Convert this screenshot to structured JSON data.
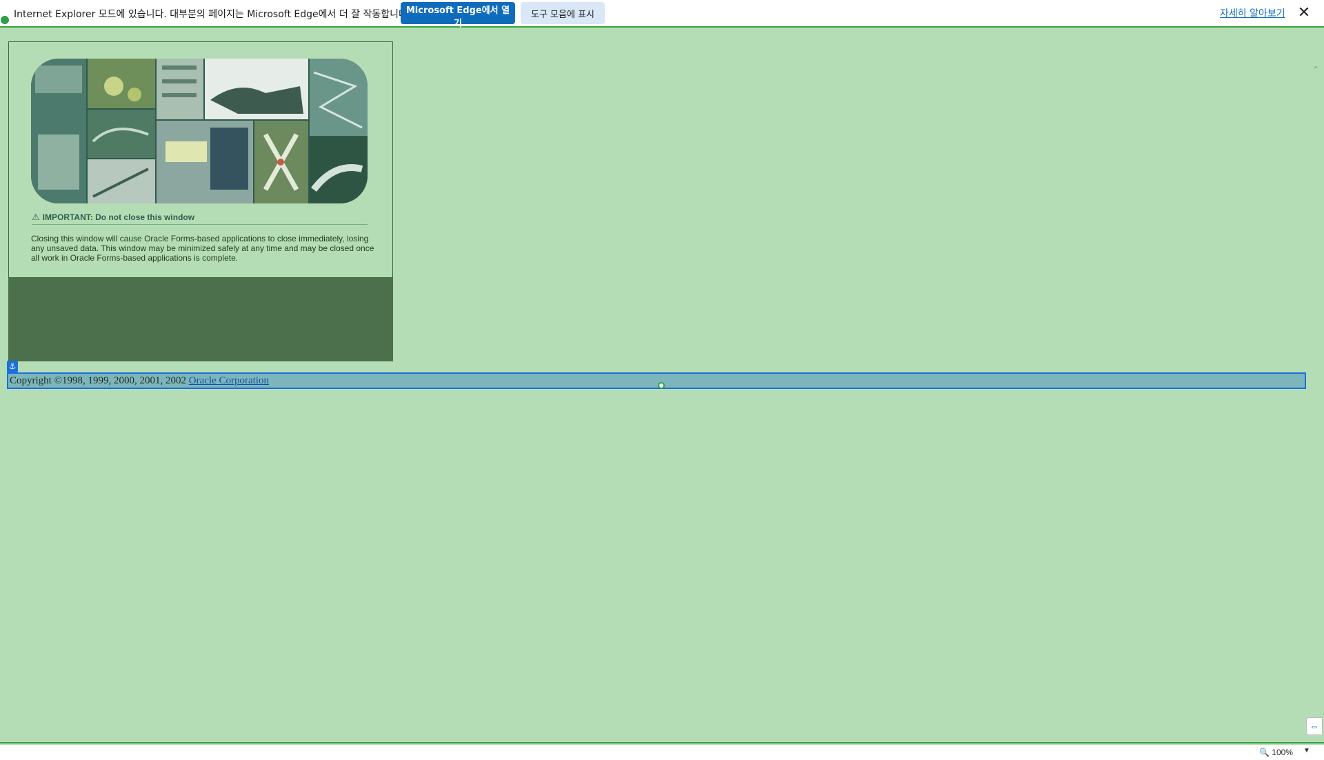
{
  "ie_bar": {
    "message": "Internet Explorer 모드에 있습니다. 대부분의 페이지는 Microsoft Edge에서 더 잘 작동합니다.",
    "open_in_edge_label": "Microsoft Edge에서 열기",
    "show_in_toolbar_label": "도구 모음에 표시",
    "learn_more_label": "자세히 알아보기",
    "close_icon": "close-icon",
    "accent_color": "#0f6cbd"
  },
  "panel": {
    "warning_title": "IMPORTANT: Do not close this window",
    "warning_text": "Closing this window will cause Oracle Forms-based applications to close immediately, losing any unsaved data. This window may be minimized safely at any time and may be closed once all work in Oracle Forms-based applications is complete.",
    "warning_icon": "warning-triangle-icon"
  },
  "footer": {
    "copyright_prefix": "Copyright ©1998, 1999, 2000, 2001, 2002",
    "company_link": "Oracle Corporation"
  },
  "status_bar": {
    "zoom": "100%"
  },
  "colors": {
    "page_background": "#b5ddb5",
    "dark_block": "#4b704b",
    "selection_border": "#1a6fd9"
  }
}
